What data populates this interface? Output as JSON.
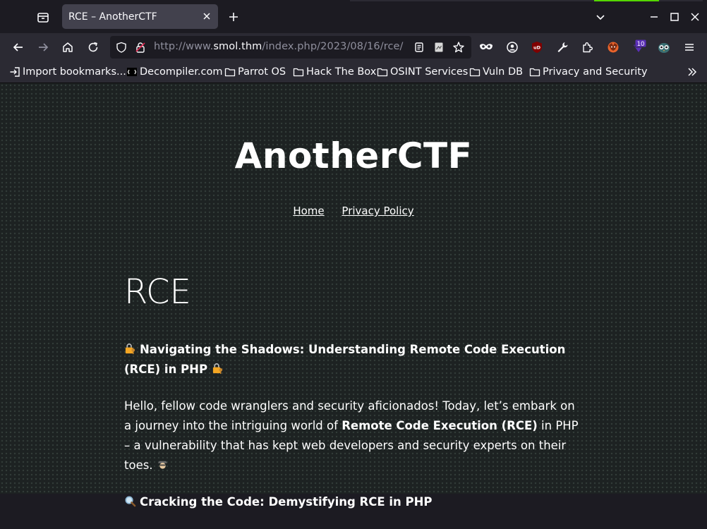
{
  "browser": {
    "tab_title": "RCE – AnotherCTF",
    "url_prefix": "http://www.",
    "url_host": "smol.thm",
    "url_path": "/index.php/2023/08/16/rce/",
    "extension_badge": "10",
    "extension_label": "uD"
  },
  "bookmarks": [
    {
      "label": "Import bookmarks...",
      "icon": "import-icon"
    },
    {
      "label": "Decompiler.com",
      "icon": "decompiler-icon"
    },
    {
      "label": "Parrot OS",
      "icon": "folder-icon"
    },
    {
      "label": "Hack The Box",
      "icon": "folder-icon"
    },
    {
      "label": "OSINT Services",
      "icon": "folder-icon"
    },
    {
      "label": "Vuln DB",
      "icon": "folder-icon"
    },
    {
      "label": "Privacy and Security",
      "icon": "folder-icon"
    }
  ],
  "site": {
    "title": "AnotherCTF",
    "nav": [
      "Home",
      "Privacy Policy"
    ]
  },
  "post": {
    "title": "RCE",
    "heading1": "Navigating the Shadows: Understanding Remote Code Execution (RCE) in PHP",
    "para1_a": "Hello, fellow code wranglers and security aficionados! Today, let’s embark on a journey into the intriguing world of ",
    "para1_bold": "Remote Code Execution (RCE)",
    "para1_b": " in PHP – a vulnerability that has kept web developers and security experts on their toes.",
    "heading2": "Cracking the Code: Demystifying RCE in PHP"
  },
  "colors": {
    "page_bg": "#1d2222",
    "chrome_bg": "#2b2a33",
    "tab_active": "#42414d",
    "ublock_red": "#800000",
    "badge_purple": "#5b2fb8"
  }
}
